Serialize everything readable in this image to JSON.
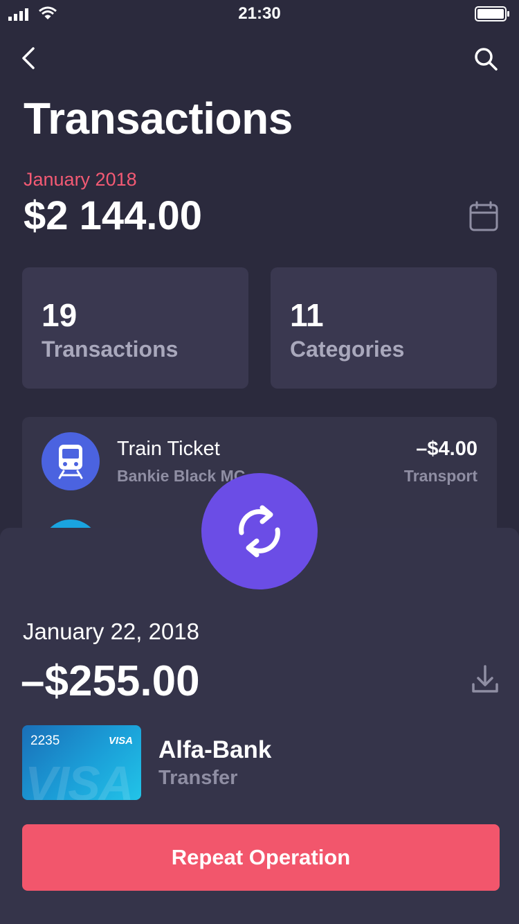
{
  "status_bar": {
    "time": "21:30"
  },
  "header": {
    "title": "Transactions"
  },
  "summary": {
    "period": "January 2018",
    "total": "$2 144.00"
  },
  "stats": [
    {
      "count": "19",
      "label": "Transactions"
    },
    {
      "count": "11",
      "label": "Categories"
    }
  ],
  "transactions": [
    {
      "name": "Train Ticket",
      "card": "Bankie Black MC",
      "amount": "–$4.00",
      "category": "Transport",
      "icon": "train-icon"
    }
  ],
  "detail": {
    "date": "January 22, 2018",
    "amount": "–$255.00",
    "card_number": "2235",
    "card_brand": "VISA",
    "bank": "Alfa-Bank",
    "operation_type": "Transfer",
    "repeat_label": "Repeat Operation"
  },
  "colors": {
    "background": "#2b2a3d",
    "accent": "#f2566c",
    "fab": "#6b4de6",
    "train_icon": "#4b63e0"
  },
  "icons": [
    "back-icon",
    "search-icon",
    "calendar-icon",
    "train-icon",
    "repeat-icon",
    "download-icon"
  ]
}
